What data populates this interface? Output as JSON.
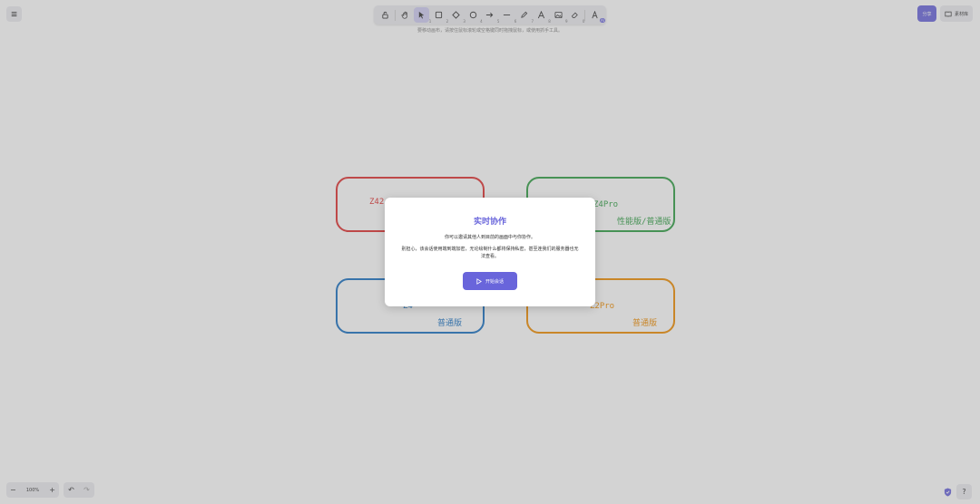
{
  "toolbar": {
    "tools": [
      {
        "name": "lock",
        "shortcut": ""
      },
      {
        "name": "hand",
        "shortcut": ""
      },
      {
        "name": "selection",
        "shortcut": "1"
      },
      {
        "name": "rectangle",
        "shortcut": "2"
      },
      {
        "name": "diamond",
        "shortcut": "3"
      },
      {
        "name": "ellipse",
        "shortcut": "4"
      },
      {
        "name": "arrow",
        "shortcut": "5"
      },
      {
        "name": "line",
        "shortcut": "6"
      },
      {
        "name": "draw",
        "shortcut": "7"
      },
      {
        "name": "text",
        "shortcut": "8"
      },
      {
        "name": "image",
        "shortcut": "9"
      },
      {
        "name": "eraser",
        "shortcut": "0"
      },
      {
        "name": "library",
        "shortcut": ""
      }
    ],
    "lib_badge": "AI"
  },
  "hint": "要移动画布，请按住鼠标滚轮或空格键同时拖拽鼠标，或使用抓手工具。",
  "cards": [
    {
      "title": "Z42",
      "sub": "",
      "color": "#e03131"
    },
    {
      "title": "Z4Pro",
      "sub": "性能版/普通版",
      "color": "#2f9e44"
    },
    {
      "title": "Z4",
      "sub": "普通版",
      "color": "#1971c2"
    },
    {
      "title": "Z2Pro",
      "sub": "普通版",
      "color": "#f08c00"
    }
  ],
  "modal": {
    "title": "实时协作",
    "line1": "你可以邀请其他人到目前的画面中与你协作。",
    "line2": "别担心，该会话使用端到端加密，无论绘制什么都将保持私密，甚至连我们的服务器也无法查看。",
    "button": "开始会话"
  },
  "top_right": {
    "share": "分享",
    "library": "素材库"
  },
  "zoom": {
    "minus": "−",
    "value": "100%",
    "plus": "+"
  },
  "undo": {
    "undo": "↶",
    "redo": "↷"
  },
  "help": "?"
}
